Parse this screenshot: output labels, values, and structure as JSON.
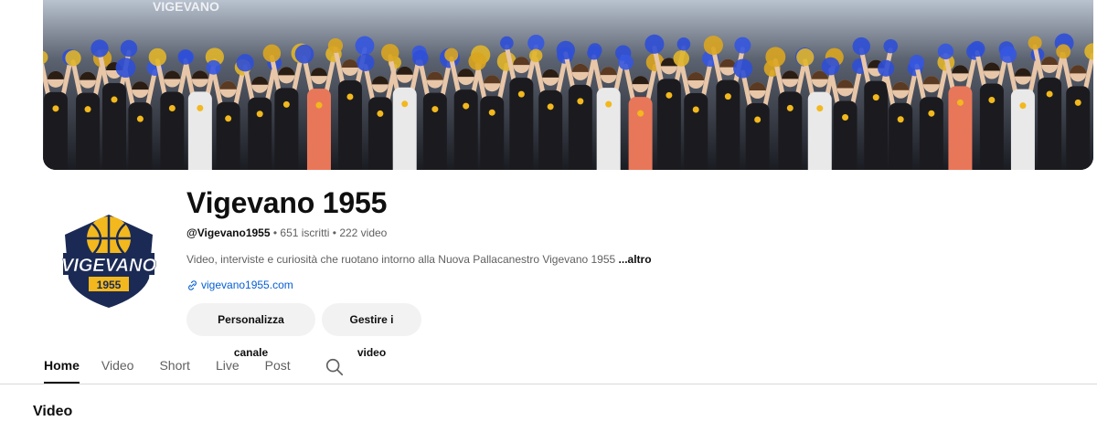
{
  "banner": {
    "alt": "Vigevano 1955 supporters banner",
    "banner_text": "VIGEVANO"
  },
  "avatar": {
    "logo_text": "VIGEVANO",
    "logo_year": "1955"
  },
  "channel": {
    "name": "Vigevano 1955",
    "handle": "@Vigevano1955",
    "separator": " • ",
    "subscribers": "651 iscritti",
    "videos": "222 video",
    "description": "Video, interviste e curiosità che ruotano intorno alla Nuova Pallacanestro Vigevano 1955 ",
    "more": "...altro",
    "link": "vigevano1955.com"
  },
  "buttons": {
    "customize": "Personalizza canale",
    "manage": "Gestire i video"
  },
  "tabs": [
    {
      "label": "Home",
      "active": true
    },
    {
      "label": "Video",
      "active": false
    },
    {
      "label": "Short",
      "active": false
    },
    {
      "label": "Live",
      "active": false
    },
    {
      "label": "Post",
      "active": false
    }
  ],
  "section": {
    "title": "Video"
  },
  "colors": {
    "link": "#065fd4",
    "logo_navy": "#1b2a55",
    "logo_gold": "#f2b81d"
  },
  "icons": {
    "link": "link-icon",
    "search": "search-icon"
  }
}
